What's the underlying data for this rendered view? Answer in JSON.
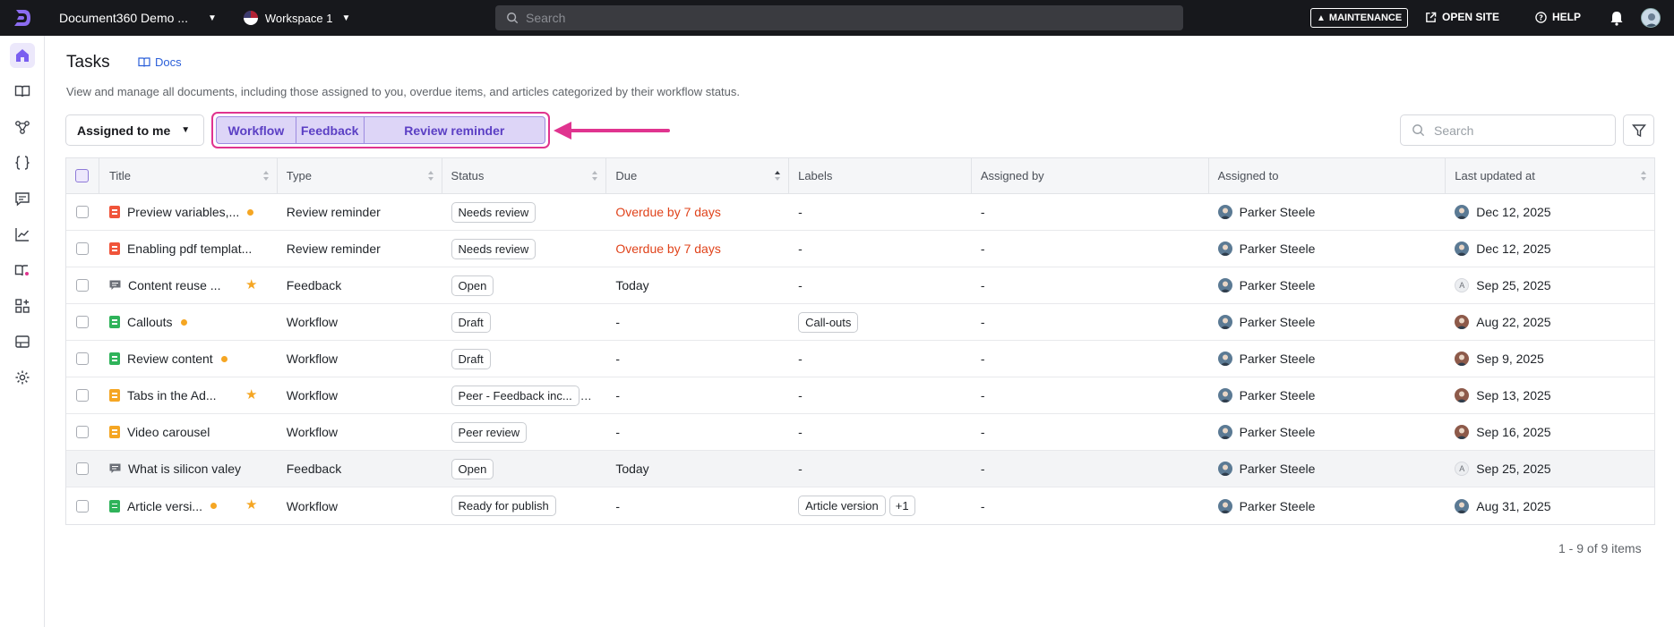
{
  "topbar": {
    "project_name": "Document360 Demo ...",
    "workspace": "Workspace 1",
    "search_placeholder": "Search",
    "maintenance": "MAINTENANCE",
    "open_site": "OPEN SITE",
    "help": "HELP"
  },
  "page": {
    "title": "Tasks",
    "docs_link": "Docs",
    "description": "View and manage all documents, including those assigned to you, overdue items, and articles categorized by their workflow status."
  },
  "filters": {
    "assigned": "Assigned to me",
    "segments": [
      "Workflow",
      "Feedback",
      "Review reminder"
    ],
    "search_placeholder": "Search"
  },
  "table": {
    "columns": [
      "Title",
      "Type",
      "Status",
      "Due",
      "Labels",
      "Assigned by",
      "Assigned to",
      "Last updated at"
    ],
    "rows": [
      {
        "title": "Preview variables,...",
        "icon": "doc-red",
        "dot": true,
        "star": false,
        "type": "Review reminder",
        "status": "Needs review",
        "due": "Overdue by 7 days",
        "overdue": true,
        "labels": "-",
        "label_extra": "",
        "assigned_by": "-",
        "assigned_to": "Parker Steele",
        "updated": "Dec 12, 2025",
        "upd_avatar": "a1"
      },
      {
        "title": "Enabling pdf templat...",
        "icon": "doc-red",
        "dot": false,
        "star": false,
        "type": "Review reminder",
        "status": "Needs review",
        "due": "Overdue by 7 days",
        "overdue": true,
        "labels": "-",
        "label_extra": "",
        "assigned_by": "-",
        "assigned_to": "Parker Steele",
        "updated": "Dec 12, 2025",
        "upd_avatar": "a1"
      },
      {
        "title": "Content reuse ...",
        "icon": "feedback",
        "dot": false,
        "star": true,
        "type": "Feedback",
        "status": "Open",
        "due": "Today",
        "overdue": false,
        "labels": "-",
        "label_extra": "",
        "assigned_by": "-",
        "assigned_to": "Parker Steele",
        "updated": "Sep 25, 2025",
        "upd_avatar": "a3"
      },
      {
        "title": "Callouts",
        "icon": "doc-green",
        "dot": true,
        "star": false,
        "type": "Workflow",
        "status": "Draft",
        "due": "-",
        "overdue": false,
        "labels": "Call-outs",
        "label_extra": "",
        "assigned_by": "-",
        "assigned_to": "Parker Steele",
        "updated": "Aug 22, 2025",
        "upd_avatar": "a2"
      },
      {
        "title": "Review content",
        "icon": "doc-green",
        "dot": true,
        "star": false,
        "type": "Workflow",
        "status": "Draft",
        "due": "-",
        "overdue": false,
        "labels": "-",
        "label_extra": "",
        "assigned_by": "-",
        "assigned_to": "Parker Steele",
        "updated": "Sep 9, 2025",
        "upd_avatar": "a2"
      },
      {
        "title": "Tabs in the Ad...",
        "icon": "doc-orange",
        "dot": false,
        "star": true,
        "type": "Workflow",
        "status": "Peer - Feedback inc...",
        "due": "-",
        "overdue": false,
        "labels": "-",
        "label_extra": "",
        "assigned_by": "-",
        "assigned_to": "Parker Steele",
        "updated": "Sep 13, 2025",
        "upd_avatar": "a2"
      },
      {
        "title": "Video carousel",
        "icon": "doc-orange",
        "dot": false,
        "star": false,
        "type": "Workflow",
        "status": "Peer review",
        "due": "-",
        "overdue": false,
        "labels": "-",
        "label_extra": "",
        "assigned_by": "-",
        "assigned_to": "Parker Steele",
        "updated": "Sep 16, 2025",
        "upd_avatar": "a2"
      },
      {
        "title": "What is silicon valey",
        "icon": "feedback",
        "dot": false,
        "star": false,
        "type": "Feedback",
        "status": "Open",
        "due": "Today",
        "overdue": false,
        "labels": "-",
        "label_extra": "",
        "assigned_by": "-",
        "assigned_to": "Parker Steele",
        "updated": "Sep 25, 2025",
        "upd_avatar": "a3"
      },
      {
        "title": "Article versi...",
        "icon": "doc-green",
        "dot": true,
        "star": true,
        "type": "Workflow",
        "status": "Ready for publish",
        "due": "-",
        "overdue": false,
        "labels": "Article version",
        "label_extra": "+1",
        "assigned_by": "-",
        "assigned_to": "Parker Steele",
        "updated": "Aug 31, 2025",
        "upd_avatar": "a1"
      }
    ]
  },
  "pagination": {
    "summary": "1 - 9 of 9 items"
  },
  "avatar_letter": "A",
  "colors": {
    "accent": "#5b3fc4",
    "highlight": "#e0348f",
    "overdue": "#e0431b",
    "doc-red": "#f0543a",
    "doc-green": "#2fb35a",
    "doc-orange": "#f5a623",
    "star": "#f5a623"
  }
}
